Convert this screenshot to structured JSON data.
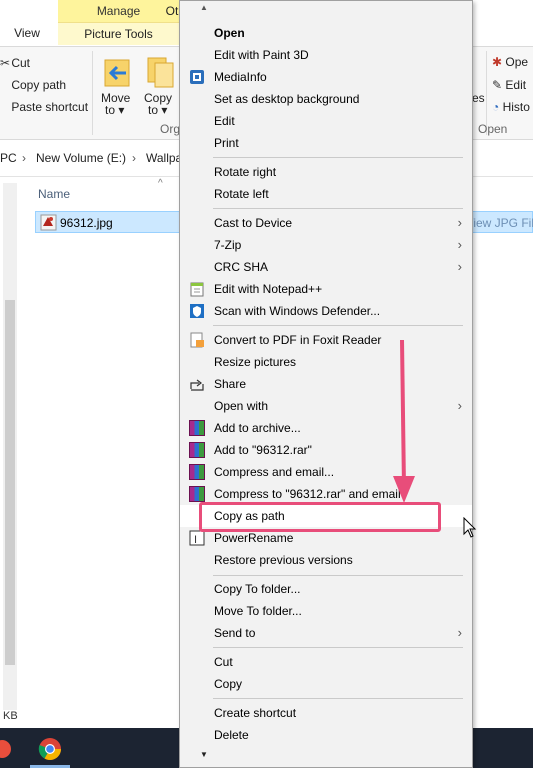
{
  "ribbon": {
    "tabs": {
      "manage": "Manage",
      "picture_tools": "Picture Tools",
      "view": "View",
      "other_partial": "Ot"
    },
    "clipboard": {
      "cut": "Cut",
      "copy_path": "Copy path",
      "paste_shortcut": "Paste shortcut"
    },
    "organize": {
      "move_to_line1": "Move",
      "move_to_line2": "to",
      "copy_to_line1": "Copy",
      "copy_to_line2": "to",
      "group_partial": "Org"
    },
    "open_group": {
      "open_partial": "Ope",
      "edit": "Edit",
      "history_partial": "Histo",
      "es_partial": "es",
      "group_label": "Open"
    }
  },
  "address": {
    "crumbs": [
      "PC",
      "New Volume (E:)",
      "Wallpa"
    ],
    "separator": "›"
  },
  "file_list": {
    "column_name": "Name",
    "file_name": "96312.jpg",
    "file_type_partial": "/iew JPG File",
    "size_partial": "KB"
  },
  "context_menu": {
    "items": [
      {
        "label": "Open",
        "bold": true
      },
      {
        "label": "Edit with Paint 3D"
      },
      {
        "label": "MediaInfo",
        "icon": "mediainfo-icon"
      },
      {
        "label": "Set as desktop background"
      },
      {
        "label": "Edit"
      },
      {
        "label": "Print"
      },
      {
        "label": "Rotate right"
      },
      {
        "label": "Rotate left"
      },
      {
        "label": "Cast to Device",
        "submenu": true
      },
      {
        "label": "7-Zip",
        "submenu": true
      },
      {
        "label": "CRC SHA",
        "submenu": true
      },
      {
        "label": "Edit with Notepad++",
        "icon": "notepad-plus-plus-icon"
      },
      {
        "label": "Scan with Windows Defender...",
        "icon": "windows-defender-icon"
      },
      {
        "label": "Convert to PDF in Foxit Reader",
        "icon": "foxit-pdf-icon"
      },
      {
        "label": "Resize pictures"
      },
      {
        "label": "Share",
        "icon": "share-icon"
      },
      {
        "label": "Open with",
        "submenu": true
      },
      {
        "label": "Add to archive...",
        "icon": "winrar-icon"
      },
      {
        "label": "Add to \"96312.rar\"",
        "icon": "winrar-icon"
      },
      {
        "label": "Compress and email...",
        "icon": "winrar-icon"
      },
      {
        "label": "Compress to \"96312.rar\" and email",
        "icon": "winrar-icon"
      },
      {
        "label": "Copy as path",
        "highlighted": true
      },
      {
        "label": "PowerRename",
        "icon": "powerrename-icon"
      },
      {
        "label": "Restore previous versions"
      },
      {
        "label": "Copy To folder..."
      },
      {
        "label": "Move To folder..."
      },
      {
        "label": "Send to",
        "submenu": true
      },
      {
        "label": "Cut"
      },
      {
        "label": "Copy"
      },
      {
        "label": "Create shortcut"
      },
      {
        "label": "Delete"
      }
    ],
    "submenu_arrow": "›",
    "scroll_up": "▲",
    "scroll_down": "▼"
  },
  "colors": {
    "highlight_box": "#e84d7a",
    "selection": "#cce8ff",
    "manage_tab": "#fef49c"
  }
}
